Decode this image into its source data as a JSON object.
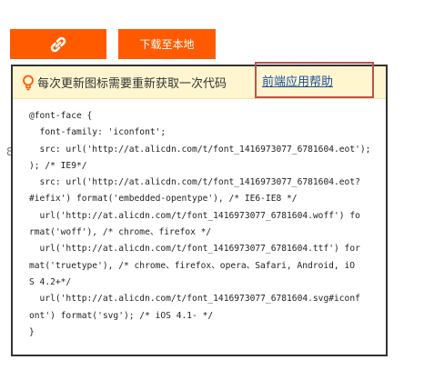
{
  "toolbar": {
    "link_icon": "link-icon",
    "download_label": "下载至本地",
    "accent_color": "#ff5a00"
  },
  "side_number": "8",
  "tip": {
    "icon": "lightbulb-icon",
    "text": "每次更新图标需要重新获取一次代码",
    "help_link": "前端应用帮助",
    "bg_color": "#fff6d0",
    "highlight_color": "#c0504d"
  },
  "code": {
    "lines": [
      "@font-face {",
      "  font-family: 'iconfont';",
      "  src: url('http://at.alicdn.com/t/font_1416973077_6781604.eot');",
      "); /* IE9*/",
      "  src: url('http://at.alicdn.com/t/font_1416973077_6781604.eot?",
      "#iefix') format('embedded-opentype'), /* IE6-IE8 */",
      "  url('http://at.alicdn.com/t/font_1416973077_6781604.woff') fo",
      "rmat('woff'), /* chrome、firefox */",
      "  url('http://at.alicdn.com/t/font_1416973077_6781604.ttf') for",
      "mat('truetype'), /* chrome、firefox、opera、Safari, Android, iO",
      "S 4.2+*/",
      "  url('http://at.alicdn.com/t/font_1416973077_6781604.svg#iconf",
      "ont') format('svg'); /* iOS 4.1- */",
      "}"
    ]
  }
}
